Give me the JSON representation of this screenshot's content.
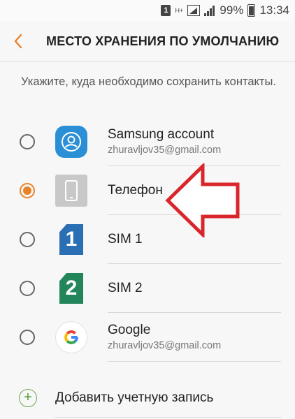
{
  "status_bar": {
    "notification_badge": "1",
    "network_type": "H+",
    "battery_percent": "99%",
    "time": "13:34"
  },
  "header": {
    "title": "МЕСТО ХРАНЕНИЯ ПО УМОЛЧАНИЮ",
    "back_icon": "chevron-left-icon"
  },
  "description": "Укажите, куда необходимо сохранить контакты.",
  "options": [
    {
      "title": "Samsung account",
      "subtitle": "zhuravljov35@gmail.com",
      "icon": "samsung-account-icon",
      "selected": false
    },
    {
      "title": "Телефон",
      "subtitle": "",
      "icon": "phone-icon",
      "selected": true
    },
    {
      "title": "SIM 1",
      "subtitle": "",
      "icon": "sim1-icon",
      "icon_text": "1",
      "selected": false
    },
    {
      "title": "SIM 2",
      "subtitle": "",
      "icon": "sim2-icon",
      "icon_text": "2",
      "selected": false
    },
    {
      "title": "Google",
      "subtitle": "zhuravljov35@gmail.com",
      "icon": "google-icon",
      "selected": false
    }
  ],
  "add_account": {
    "label": "Добавить учетную запись",
    "icon": "plus-icon"
  },
  "colors": {
    "accent": "#e8832b",
    "annotation_arrow": "#d9262b",
    "samsung_blue": "#2b8fd6",
    "sim1": "#2a6fb3",
    "sim2": "#23865a"
  }
}
